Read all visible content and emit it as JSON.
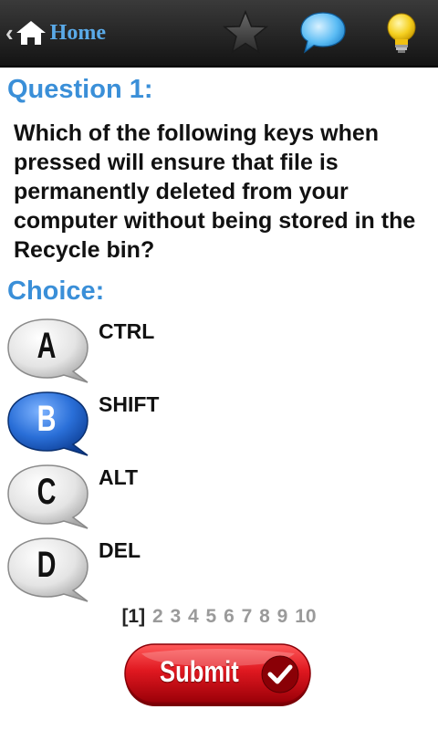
{
  "topbar": {
    "home_label": "Home",
    "icons": [
      "star-icon",
      "speech-bubble-icon",
      "lightbulb-icon"
    ]
  },
  "question": {
    "title": "Question 1:",
    "text": "Which of the following keys when pressed will ensure that file is permanently deleted from your computer without being stored in the Recycle bin?"
  },
  "choices": {
    "title": "Choice:",
    "items": [
      {
        "letter": "A",
        "label": "CTRL",
        "selected": false
      },
      {
        "letter": "B",
        "label": "SHIFT",
        "selected": true
      },
      {
        "letter": "C",
        "label": "ALT",
        "selected": false
      },
      {
        "letter": "D",
        "label": "DEL",
        "selected": false
      }
    ]
  },
  "pager": {
    "current": "[1]",
    "pages": [
      "2",
      "3",
      "4",
      "5",
      "6",
      "7",
      "8",
      "9",
      "10"
    ]
  },
  "submit": {
    "label": "Submit"
  },
  "colors": {
    "accent_blue": "#3a8fd8",
    "home_blue": "#5aaae8",
    "submit_red": "#d0121a",
    "selected_bubble": "#1a5fc8"
  }
}
